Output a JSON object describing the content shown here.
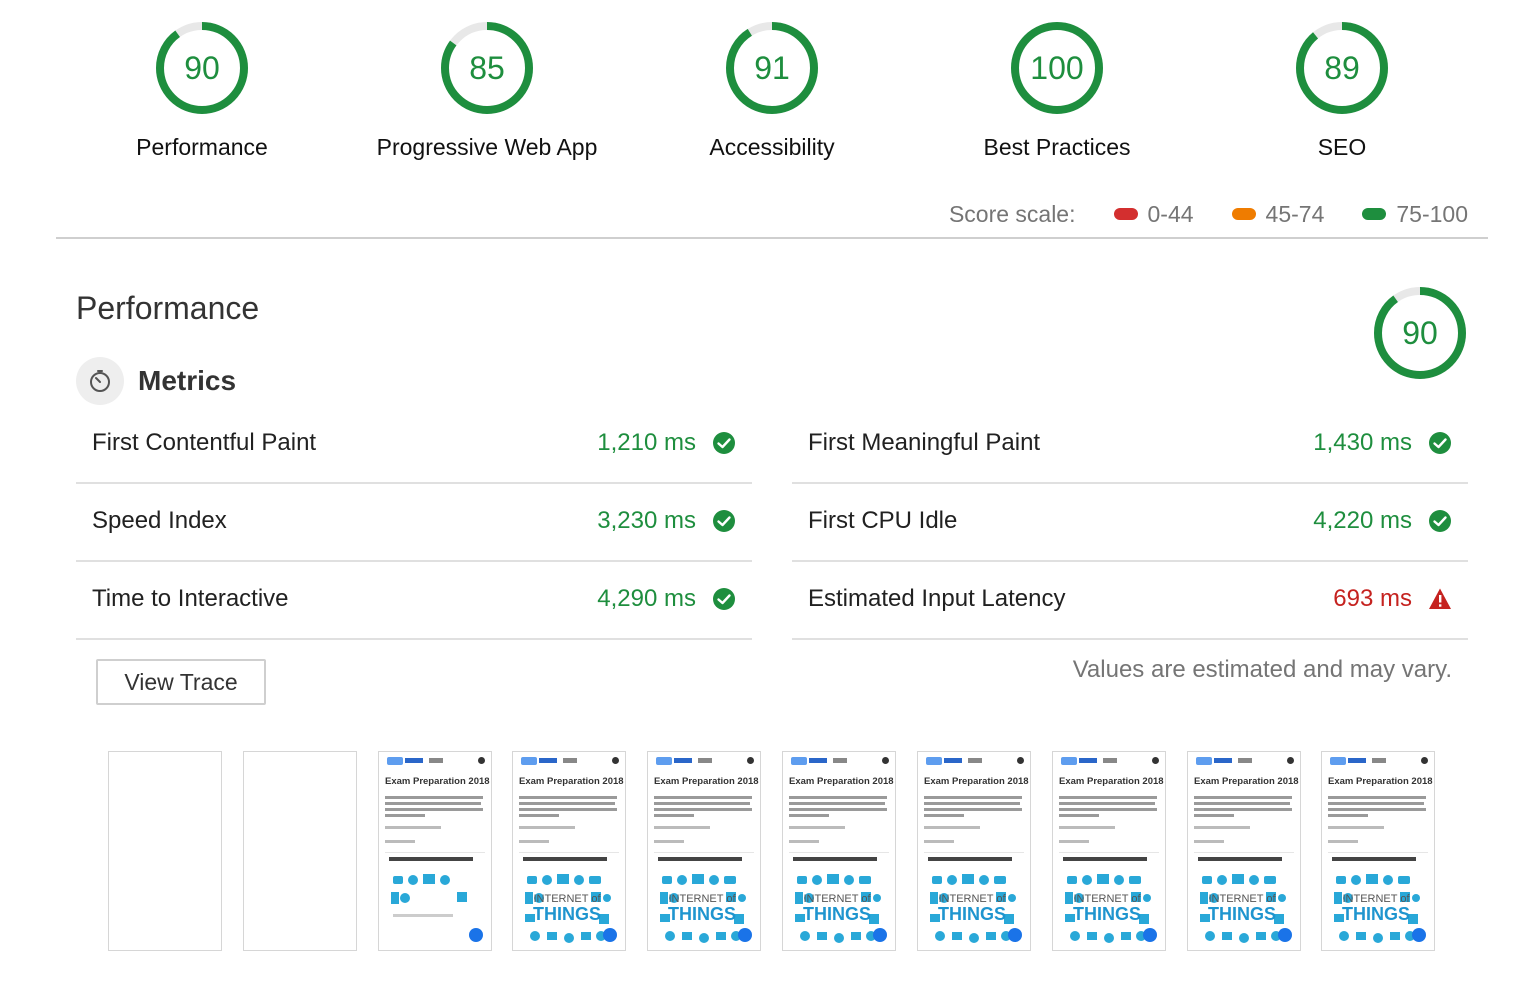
{
  "gauges": [
    {
      "score": "90",
      "label": "Performance",
      "value": 90
    },
    {
      "score": "85",
      "label": "Progressive Web App",
      "value": 85
    },
    {
      "score": "91",
      "label": "Accessibility",
      "value": 91
    },
    {
      "score": "100",
      "label": "Best Practices",
      "value": 100
    },
    {
      "score": "89",
      "label": "SEO",
      "value": 89
    }
  ],
  "score_scale": {
    "label": "Score scale:",
    "ranges": [
      {
        "text": "0-44",
        "color": "#d32f2f"
      },
      {
        "text": "45-74",
        "color": "#ef7c00"
      },
      {
        "text": "75-100",
        "color": "#1e8e3e"
      }
    ]
  },
  "performance": {
    "title": "Performance",
    "score": "90",
    "score_value": 90,
    "metrics_title": "Metrics",
    "metrics_icon": "timer-icon",
    "metrics": [
      {
        "name": "First Contentful Paint",
        "value": "1,210 ms",
        "status": "pass"
      },
      {
        "name": "First Meaningful Paint",
        "value": "1,430 ms",
        "status": "pass"
      },
      {
        "name": "Speed Index",
        "value": "3,230 ms",
        "status": "pass"
      },
      {
        "name": "First CPU Idle",
        "value": "4,220 ms",
        "status": "pass"
      },
      {
        "name": "Time to Interactive",
        "value": "4,290 ms",
        "status": "pass"
      },
      {
        "name": "Estimated Input Latency",
        "value": "693 ms",
        "status": "fail"
      }
    ],
    "view_trace_label": "View Trace",
    "disclaimer": "Values are estimated and may vary."
  },
  "filmstrip": {
    "frame_title": "Exam Preparation 2018",
    "frames": [
      "blank",
      "blank",
      "loading",
      "loaded",
      "loaded",
      "loaded",
      "loaded",
      "loaded",
      "loaded",
      "loaded"
    ]
  },
  "colors": {
    "pass": "#1e8e3e",
    "fail": "#c5221f",
    "track": "#e8e8e8"
  }
}
